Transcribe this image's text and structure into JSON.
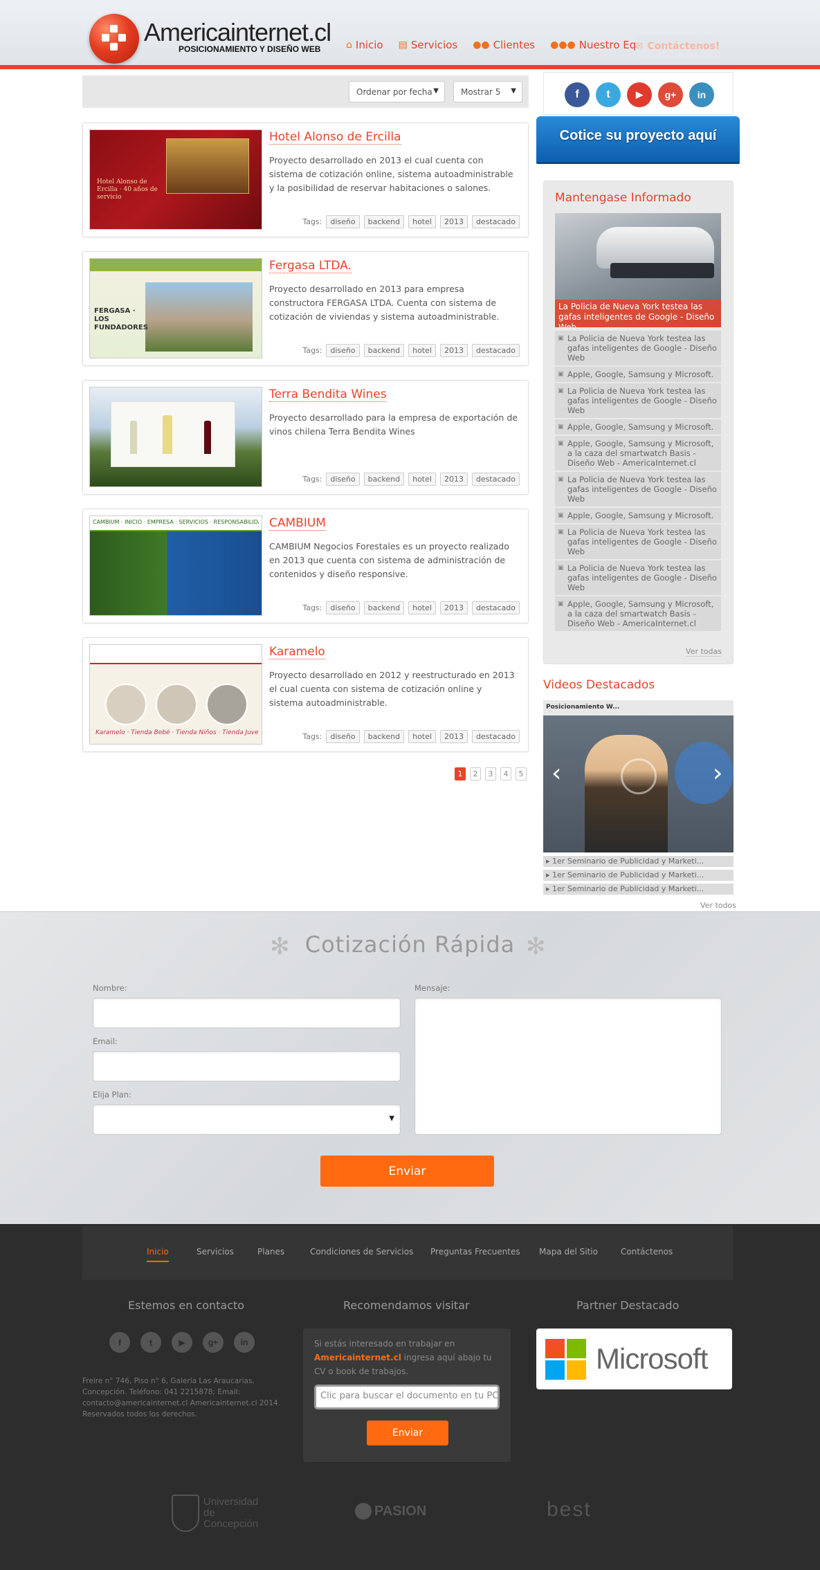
{
  "header": {
    "logo_title": "Americainternet.cl",
    "logo_subtitle": "POSICIONAMIENTO Y DISEÑO WEB",
    "nav": [
      {
        "label": "Inicio",
        "icon": "home-icon"
      },
      {
        "label": "Servicios",
        "icon": "document-icon"
      },
      {
        "label": "Clientes",
        "icon": "users-icon"
      },
      {
        "label": "Nuestro Equipo",
        "icon": "team-icon"
      }
    ],
    "contact_label": "Contáctenos!"
  },
  "toolbar": {
    "sort_value": "Ordenar por fecha",
    "show_value": "Mostrar 5"
  },
  "projects": [
    {
      "title": "Hotel Alonso de Ercilla",
      "desc": "Proyecto desarrollado en 2013 el cual cuenta con sistema de cotización online, sistema autoadministrable y la posibilidad de reservar habitaciones o salones.",
      "thumb_text": "Hotel Alonso de Ercilla · 40 años de servicio"
    },
    {
      "title": "Fergasa LTDA.",
      "desc": "Proyecto desarrollado en 2013 para empresa constructora FERGASA LTDA. Cuenta con sistema de cotización de viviendas y sistema autoadministrable.",
      "thumb_text": "FERGASA · LOS FUNDADORES"
    },
    {
      "title": "Terra Bendita Wines",
      "desc": "Proyecto desarrollado para la empresa de exportación de vinos chilena Terra Bendita Wines",
      "thumb_text": ""
    },
    {
      "title": "CAMBIUM",
      "desc": "CAMBIUM Negocios Forestales es un proyecto realizado en 2013 que cuenta con sistema de administración de contenidos y diseño responsive.",
      "thumb_text": "CAMBIUM · INICIO · EMPRESA · SERVICIOS · RESPONSABILIDAD"
    },
    {
      "title": "Karamelo",
      "desc": "Proyecto desarrollado en 2012 y reestructurado en 2013 el cual cuenta con sistema de cotización online y sistema autoadministrable.",
      "thumb_text": "Karamelo · Tienda Bebé · Tienda Niños · Tienda Juvenil"
    }
  ],
  "tags_label": "Tags:",
  "tags": [
    "diseño",
    "backend",
    "hotel",
    "2013",
    "destacado"
  ],
  "pagination": [
    "1",
    "2",
    "3",
    "4",
    "5"
  ],
  "sidebar": {
    "social": [
      "f",
      "t",
      "▶",
      "g+",
      "in"
    ],
    "quote_button": "Cotice su proyecto aquí",
    "news_title": "Mantengase Informado",
    "news_feature": "La Policia de Nueva York testea las gafas inteligentes de Google - Diseño Web",
    "news_items": [
      "La Policia de Nueva York testea las gafas inteligentes de Google - Diseño Web",
      "Apple, Google, Samsung y Microsoft.",
      "La Policia de Nueva York testea las gafas inteligentes de Google - Diseño Web",
      "Apple, Google, Samsung y Microsoft.",
      "Apple, Google, Samsung y Microsoft, a la caza del smartwatch Basis - Diseño Web - AmericaInternet.cl",
      "La Policia de Nueva York testea las gafas inteligentes de Google - Diseño Web",
      "Apple, Google, Samsung y Microsoft.",
      "La Policia de Nueva York testea las gafas inteligentes de Google - Diseño Web",
      "La Policia de Nueva York testea las gafas inteligentes de Google - Diseño Web",
      "Apple, Google, Samsung y Microsoft, a la caza del smartwatch Basis - Diseño Web - AmericaInternet.cl"
    ],
    "news_more": "Ver todas",
    "videos_title": "Videos Destacados",
    "video_caption": "Posicionamiento W...",
    "video_items": [
      "1er Seminario de Publicidad y Marketi...",
      "1er Seminario de Publicidad y Marketi...",
      "1er Seminario de Publicidad y Marketi..."
    ],
    "videos_more": "Ver todos"
  },
  "quick_quote": {
    "title": "Cotización Rápida",
    "name_label": "Nombre:",
    "email_label": "Email:",
    "plan_label": "Elija Plan:",
    "message_label": "Mensaje:",
    "send_label": "Enviar"
  },
  "footer": {
    "nav": [
      "Inicio",
      "Servicios",
      "Planes",
      "Condiciones de Servicios",
      "Preguntas Frecuentes",
      "Mapa del Sitio",
      "Contáctenos"
    ],
    "contact_title": "Estemos en contacto",
    "visit_title": "Recomendamos visitar",
    "partner_title": "Partner Destacado",
    "address": "Freire n° 746, Piso n° 6, Galería Las Araucarias, Concepción. Teléfono: 041 2215878; Email: contacto@americainternet.cl Americainternet.cl 2014. Reservados todos los derechos.",
    "rec_text_pre": "Si estás interesado en trabajar en ",
    "rec_text_brand": "Americainternet.cl",
    "rec_text_post": " ingresa aquí abajo tu CV o book de trabajos.",
    "rec_placeholder": "Clic para buscar el documento en tu PC",
    "rec_button": "Enviar",
    "partner_name": "Microsoft",
    "logos": [
      "Universidad de Concepción",
      "PASION",
      "best"
    ]
  },
  "colors": {
    "accent": "#e8432a",
    "orange": "#ff6a10",
    "blue": "#1a6fc2"
  }
}
